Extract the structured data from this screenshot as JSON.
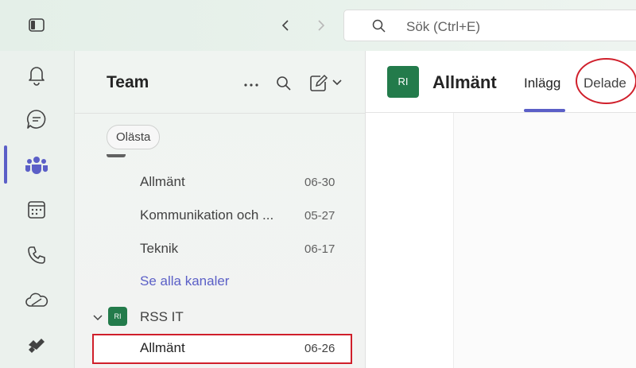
{
  "search": {
    "placeholder": "Sök (Ctrl+E)"
  },
  "icons": {
    "sidebar_toggle": "sidebar-toggle-icon",
    "back": "chevron-left-icon",
    "forward": "chevron-right-icon",
    "search": "search-icon",
    "rail": [
      "bell-icon",
      "chat-icon",
      "teams-icon",
      "calendar-icon",
      "phone-icon",
      "onedrive-icon",
      "planner-icon"
    ]
  },
  "panel": {
    "title": "Team",
    "filter": "Olästa",
    "channels": [
      {
        "name": "Allmänt",
        "date": "06-30"
      },
      {
        "name": "Kommunikation och ...",
        "date": "05-27"
      },
      {
        "name": "Teknik",
        "date": "06-17"
      }
    ],
    "see_all": "Se alla kanaler",
    "team": {
      "avatar": "RI",
      "name": "RSS IT"
    },
    "selected_channel": {
      "name": "Allmänt",
      "date": "06-26"
    }
  },
  "header": {
    "avatar": "RI",
    "title": "Allmänt",
    "tabs": [
      "Inlägg",
      "Delade"
    ]
  },
  "colors": {
    "accent": "#5b5fc7",
    "team_avatar": "#237b4b",
    "highlight": "#d01f2b"
  }
}
